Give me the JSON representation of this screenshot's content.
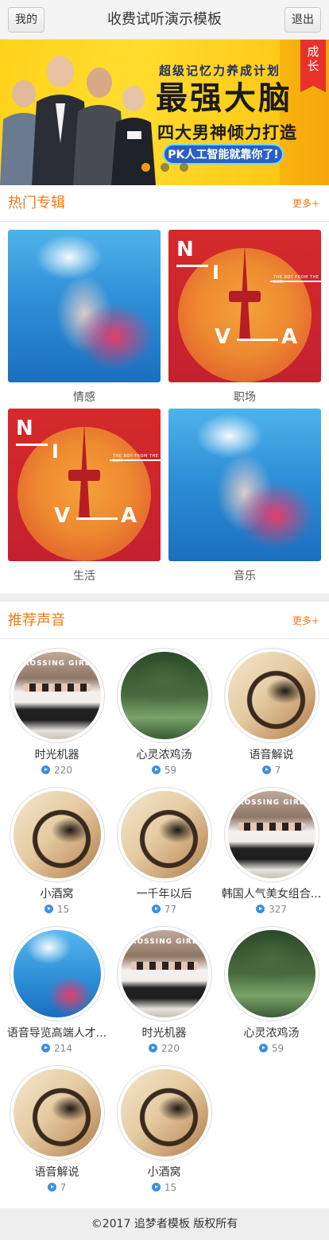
{
  "header": {
    "left_button": "我的",
    "title": "收费试听演示模板",
    "right_button": "退出"
  },
  "banner": {
    "tag": [
      "成",
      "长"
    ],
    "subtitle": "超级记忆力养成计划",
    "headline": "最强大脑",
    "tagline": "四大男神倾力打造",
    "pill": "PK人工智能就靠你了!",
    "slide_count": 3,
    "active_slide": 0
  },
  "albums_section": {
    "title": "热门专辑",
    "more": "更多+",
    "items": [
      {
        "label": "情感",
        "image": "underwater-couple"
      },
      {
        "label": "职场",
        "image": "niva-poster"
      },
      {
        "label": "生活",
        "image": "niva-poster"
      },
      {
        "label": "音乐",
        "image": "underwater-couple"
      }
    ],
    "poster_text": {
      "n": "N",
      "i": "I",
      "v": "V",
      "a": "A",
      "small": "THE BOY FROM THE SUN"
    }
  },
  "sounds_section": {
    "title": "推荐声音",
    "more": "更多+",
    "items": [
      {
        "name": "时光机器",
        "plays": "220",
        "image": "girl-group"
      },
      {
        "name": "心灵浓鸡汤",
        "plays": "59",
        "image": "forest"
      },
      {
        "name": "语音解说",
        "plays": "7",
        "image": "headphones"
      },
      {
        "name": "小酒窝",
        "plays": "15",
        "image": "headphones"
      },
      {
        "name": "一千年以后",
        "plays": "77",
        "image": "headphones"
      },
      {
        "name": "韩国人气美女组合...",
        "plays": "327",
        "image": "girl-group"
      },
      {
        "name": "语音导览高端人才...",
        "plays": "214",
        "image": "underwater"
      },
      {
        "name": "时光机器",
        "plays": "220",
        "image": "girl-group"
      },
      {
        "name": "心灵浓鸡汤",
        "plays": "59",
        "image": "forest"
      },
      {
        "name": "语音解说",
        "plays": "7",
        "image": "headphones"
      },
      {
        "name": "小酒窝",
        "plays": "15",
        "image": "headphones"
      }
    ],
    "group_logo": "CROSSING GIRLS"
  },
  "footer": {
    "text": "©2017 追梦者模板 版权所有"
  },
  "colors": {
    "accent": "#f27a13",
    "header_bg": "#f4f4f4",
    "banner_yellow": "#ffd21a",
    "play_icon": "#3d8fe0"
  }
}
